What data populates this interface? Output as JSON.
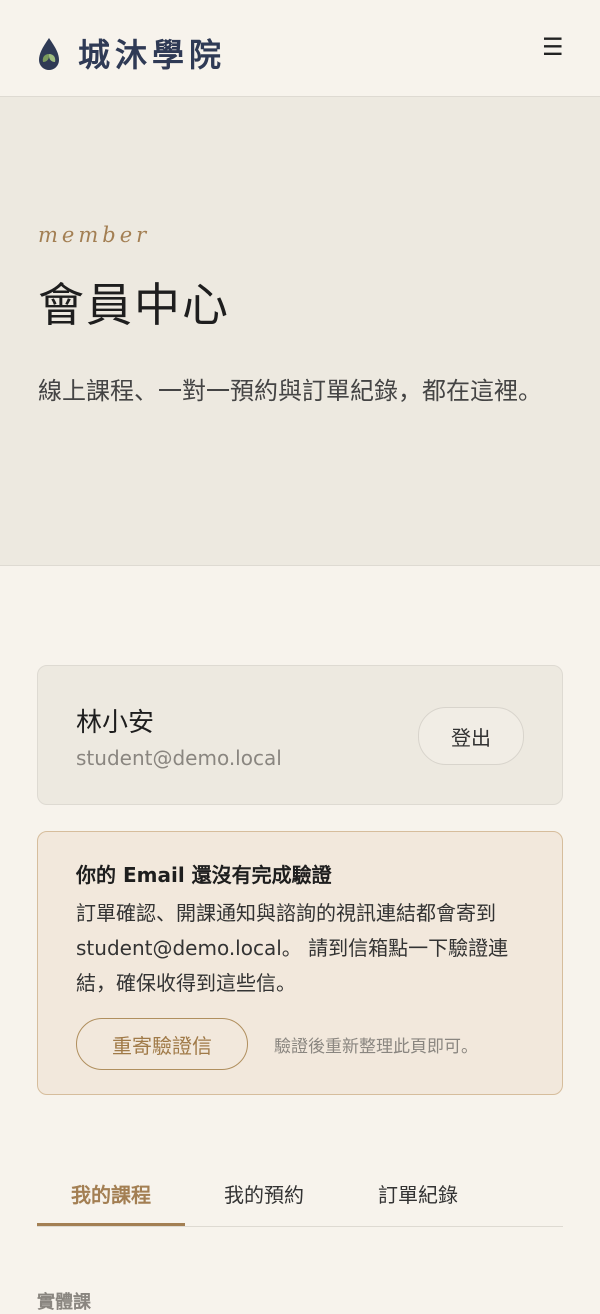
{
  "brand": {
    "name": "城沐學院"
  },
  "nav": {
    "menu_icon": "hamburger-icon",
    "menu_glyph": "☰"
  },
  "hero": {
    "eyebrow": "member",
    "title": "會員中心",
    "description": "線上課程、一對一預約與訂單紀錄，都在這裡。"
  },
  "profile": {
    "name": "林小安",
    "email": "student@demo.local",
    "logout_label": "登出"
  },
  "verify_notice": {
    "title": "你的 Email 還沒有完成驗證",
    "body": "訂單確認、開課通知與諮詢的視訊連結都會寄到 student@demo.local。 請到信箱點一下驗證連結，確保收得到這些信。",
    "resend_label": "重寄驗證信",
    "note": "驗證後重新整理此頁即可。"
  },
  "tabs": [
    {
      "label": "我的課程",
      "active": true
    },
    {
      "label": "我的預約",
      "active": false
    },
    {
      "label": "訂單紀錄",
      "active": false
    }
  ],
  "section": {
    "label": "實體課"
  },
  "colors": {
    "accent": "#a37f53",
    "brand_navy": "#2f3a55",
    "logo_green": "#7a9a5c"
  }
}
